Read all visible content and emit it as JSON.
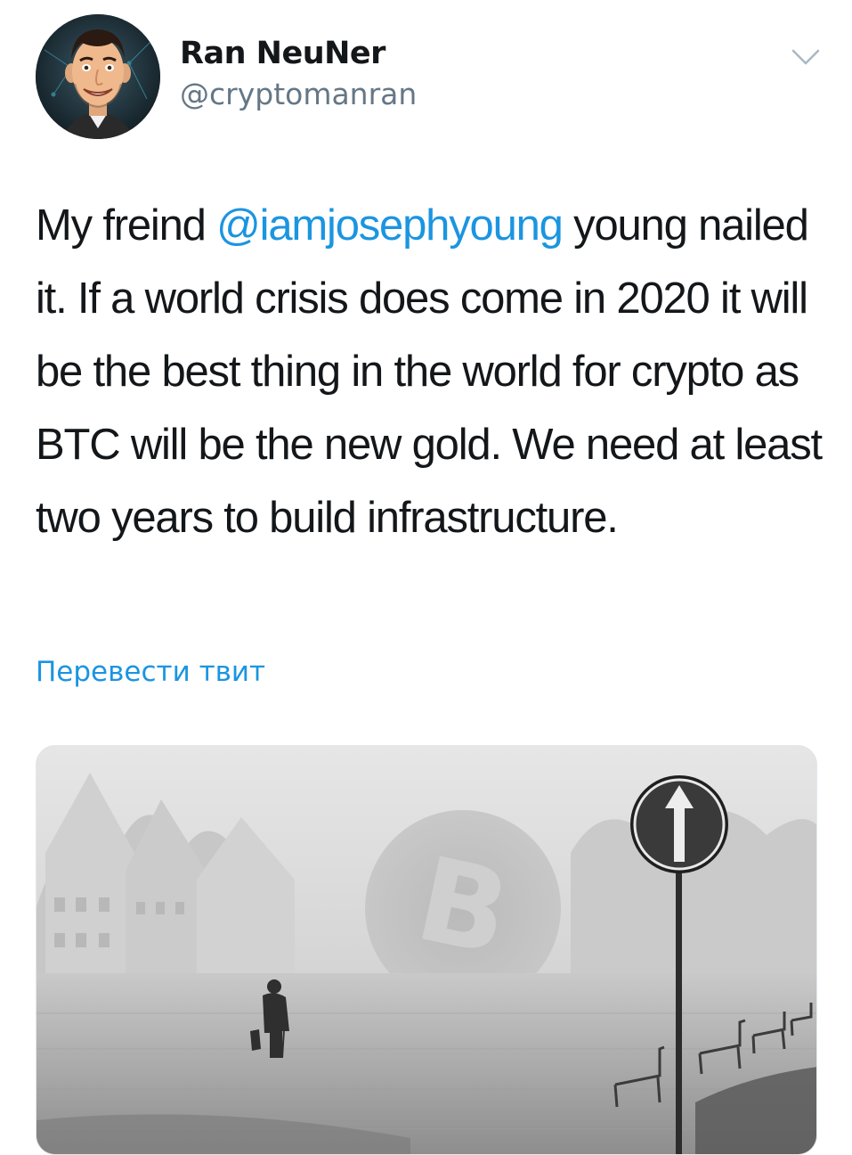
{
  "author": {
    "display_name": "Ran NeuNer",
    "handle": "@cryptomanran",
    "avatar_icon": "avatar-caricature"
  },
  "menu": {
    "icon": "chevron-down-icon"
  },
  "tweet": {
    "text_before": "My freind ",
    "mention": "@iamjosephyoung",
    "text_after": " young nailed it. If a world crisis does come in 2020 it will be the best thing in the world for crypto as BTC will be the new gold. We need at least two years to build infrastructure."
  },
  "translate_label": "Перевести твит",
  "media": {
    "kind": "photo",
    "description_icon": "foggy-street-bitcoin-photo"
  },
  "colors": {
    "link": "#1b95e0",
    "text": "#14171a",
    "muted": "#657786"
  }
}
